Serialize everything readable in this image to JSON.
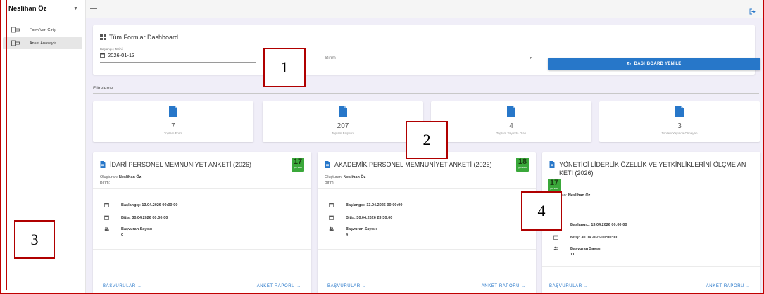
{
  "sidebar": {
    "user_name": "Neslihan Öz",
    "items": [
      {
        "label": "Form Veri Girişi",
        "icon": "form-icon",
        "active": false
      },
      {
        "label": "Anket Anasayfa",
        "icon": "form-icon",
        "active": true
      }
    ]
  },
  "topbar": {
    "menu_icon": "hamburger-icon",
    "logout_icon": "logout-icon"
  },
  "dashboard": {
    "title": "Tüm Formlar Dashboard",
    "date_label": "Başlangıç Tarihi",
    "date_value": "2026-01-13",
    "unit_placeholder": "Birim",
    "refresh_label": "DASHBOARD YENİLE"
  },
  "filter_label": "Filtreleme",
  "stats": [
    {
      "value": "7",
      "caption": "Toplam Form"
    },
    {
      "value": "207",
      "caption": "Toplam Başvuru"
    },
    {
      "value": "4",
      "caption": "Toplam Yayında Olan"
    },
    {
      "value": "3",
      "caption": "Toplam Yayında Olmayan"
    }
  ],
  "surveys": [
    {
      "title": "İDARİ PERSONEL MEMNUNİYET ANKETİ (2026)",
      "badge": "17",
      "badge_sub": "gün kaldı",
      "created_by_label": "Oluşturan:",
      "created_by": "Neslihan Öz",
      "unit_label": "Birim:",
      "start": "Başlangıç: 13.04.2026 00:00:00",
      "end": "Bitiş: 30.04.2026 00:00:00",
      "applicants_label": "Başvuran Sayısı:",
      "applicants": "0",
      "link_apps": "BAŞVURULAR →",
      "link_report": "ANKET RAPORU →"
    },
    {
      "title": "AKADEMİK PERSONEL MEMNUNİYET ANKETİ (2026)",
      "badge": "18",
      "badge_sub": "gün kaldı",
      "created_by_label": "Oluşturan:",
      "created_by": "Neslihan Öz",
      "unit_label": "Birim:",
      "start": "Başlangıç: 13.04.2026 00:00:00",
      "end": "Bitiş: 30.04.2026 23:30:00",
      "applicants_label": "Başvuran Sayısı:",
      "applicants": "4",
      "link_apps": "BAŞVURULAR →",
      "link_report": "ANKET RAPORU →"
    },
    {
      "title": "YÖNETİCİ LİDERLİK ÖZELLİK VE YETKİNLİKLERİNİ ÖLÇME AN KETİ (2026)",
      "badge": "17",
      "badge_sub": "gün kaldı",
      "created_by_label": "Oluşturan:",
      "created_by": "Neslihan Öz",
      "unit_label": "Birim:",
      "start": "Başlangıç: 13.04.2026 00:00:00",
      "end": "Bitiş: 30.04.2026 00:00:00",
      "applicants_label": "Başvuran Sayısı:",
      "applicants": "11",
      "link_apps": "BAŞVURULAR →",
      "link_report": "ANKET RAPORU →"
    }
  ],
  "annotations": [
    "1",
    "2",
    "3",
    "4"
  ],
  "colors": {
    "accent": "#2777c9",
    "badge": "#3aa83a",
    "frame": "#c00000",
    "background": "#f0eef8"
  }
}
